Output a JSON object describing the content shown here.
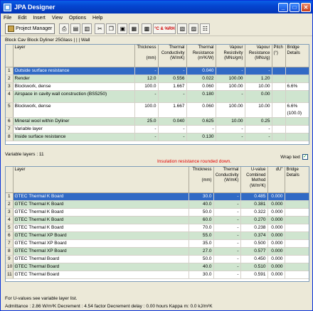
{
  "window": {
    "title": "JPA Designer"
  },
  "menu": [
    "File",
    "Edit",
    "Insert",
    "View",
    "Options",
    "Help"
  ],
  "toolbar": {
    "project_manager": "Project Manager",
    "temp_rh_label": "°C & %RH"
  },
  "construction_label": "Block Cav Block Dyliner 25Glass | | | Wall",
  "top_table": {
    "headers": [
      "Layer",
      "Thickness\n\n(mm)",
      "Thermal\nConductivity\n(W/mK)",
      "Thermal\nResistance\n(m²K/W)",
      "Vapour\nResistivity\n(MNs/gm)",
      "Vapour\nResistance\n(MNs/g)",
      "Pitch\n(°)",
      "Bridge\nDetails"
    ],
    "rows": [
      {
        "n": "1",
        "layer": "Outside surface resistance",
        "thickness": "-",
        "conductivity": "-",
        "resistance": "0.040",
        "vres": "-",
        "vr": "-",
        "pitch": "",
        "bridge": "",
        "style": "sel"
      },
      {
        "n": "2",
        "layer": "Render",
        "thickness": "12.0",
        "conductivity": "0.556",
        "resistance": "0.022",
        "vres": "100.00",
        "vr": "1.20",
        "pitch": "",
        "bridge": "",
        "style": "green"
      },
      {
        "n": "3",
        "layer": "Blockwork, dense",
        "thickness": "100.0",
        "conductivity": "1.667",
        "resistance": "0.060",
        "vres": "100.00",
        "vr": "10.00",
        "pitch": "",
        "bridge": "6.6%",
        "style": ""
      },
      {
        "n": "4",
        "layer": "Airspace in cavity wall construction (BS5250)",
        "thickness": "-",
        "conductivity": "-",
        "resistance": "0.180",
        "vres": "-",
        "vr": "0.00",
        "pitch": "",
        "bridge": "",
        "style": "green tall"
      },
      {
        "n": "5",
        "layer": "Blockwork, dense",
        "thickness": "100.0",
        "conductivity": "1.667",
        "resistance": "0.060",
        "vres": "100.00",
        "vr": "10.00",
        "pitch": "",
        "bridge": "6.6%\n(100.0)",
        "style": "tall"
      },
      {
        "n": "6",
        "layer": "Mineral wool within Dyliner",
        "thickness": "25.0",
        "conductivity": "0.040",
        "resistance": "0.625",
        "vres": "10.00",
        "vr": "0.25",
        "pitch": "",
        "bridge": "",
        "style": "green"
      },
      {
        "n": "7",
        "layer": "Variable layer",
        "thickness": "-",
        "conductivity": "-",
        "resistance": "-",
        "vres": "-",
        "vr": "-",
        "pitch": "",
        "bridge": "",
        "style": ""
      },
      {
        "n": "8",
        "layer": "Inside surface resistance",
        "thickness": "-",
        "conductivity": "-",
        "resistance": "0.130",
        "vres": "-",
        "vr": "-",
        "pitch": "",
        "bridge": "",
        "style": "green"
      }
    ]
  },
  "variable_layers_label": "Variable layers : 11",
  "insulation_note": "Insulation resistance rounded down.",
  "wrap_text_label": "Wrap text",
  "bottom_table": {
    "headers": [
      "Layer",
      "Thickness\n\n(mm)",
      "Thermal\nConductivity\n(W/mK)",
      "U-value\nCombined\nMethod\n(W/m²K)",
      "dU\"",
      "Bridge\nDetails"
    ],
    "rows": [
      {
        "n": "1",
        "layer": "GTEC Thermal K Board",
        "thickness": "30.0",
        "conductivity": "-",
        "uvalue": "0.485",
        "du": "0.000",
        "bridge": "",
        "style": "sel"
      },
      {
        "n": "2",
        "layer": "GTEC Thermal K Board",
        "thickness": "40.0",
        "conductivity": "-",
        "uvalue": "0.381",
        "du": "0.000",
        "bridge": "",
        "style": "green"
      },
      {
        "n": "3",
        "layer": "GTEC Thermal K Board",
        "thickness": "50.0",
        "conductivity": "-",
        "uvalue": "0.322",
        "du": "0.000",
        "bridge": "",
        "style": ""
      },
      {
        "n": "4",
        "layer": "GTEC Thermal K Board",
        "thickness": "60.0",
        "conductivity": "-",
        "uvalue": "0.270",
        "du": "0.000",
        "bridge": "",
        "style": "green"
      },
      {
        "n": "5",
        "layer": "GTEC Thermal K Board",
        "thickness": "70.0",
        "conductivity": "-",
        "uvalue": "0.238",
        "du": "0.000",
        "bridge": "",
        "style": ""
      },
      {
        "n": "6",
        "layer": "GTEC Thermal XP Board",
        "thickness": "55.0",
        "conductivity": "-",
        "uvalue": "0.374",
        "du": "0.000",
        "bridge": "",
        "style": "green"
      },
      {
        "n": "7",
        "layer": "GTEC Thermal XP Board",
        "thickness": "35.0",
        "conductivity": "-",
        "uvalue": "0.500",
        "du": "0.000",
        "bridge": "",
        "style": ""
      },
      {
        "n": "8",
        "layer": "GTEC Thermal XP Board",
        "thickness": "27.0",
        "conductivity": "-",
        "uvalue": "0.577",
        "du": "0.000",
        "bridge": "",
        "style": "green"
      },
      {
        "n": "9",
        "layer": "GTEC Thermal Board",
        "thickness": "50.0",
        "conductivity": "-",
        "uvalue": "0.450",
        "du": "0.000",
        "bridge": "",
        "style": ""
      },
      {
        "n": "10",
        "layer": "GTEC Thermal Board",
        "thickness": "40.0",
        "conductivity": "-",
        "uvalue": "0.510",
        "du": "0.000",
        "bridge": "",
        "style": "green"
      },
      {
        "n": "11",
        "layer": "GTEC Thermal Board",
        "thickness": "30.0",
        "conductivity": "-",
        "uvalue": "0.591",
        "du": "0.000",
        "bridge": "",
        "style": ""
      }
    ]
  },
  "status": {
    "line1": "For U-values see variable layer list.",
    "line2": "Admittance : 2.86 W/m²K    Decrement : 4.54 factor    Decrement delay : 0.00 hours Kappa m: 0.0 kJ/m²K"
  },
  "colors": {
    "selection": "#316ac5",
    "alt_row": "#cfe5cf",
    "note": "#e00000"
  }
}
